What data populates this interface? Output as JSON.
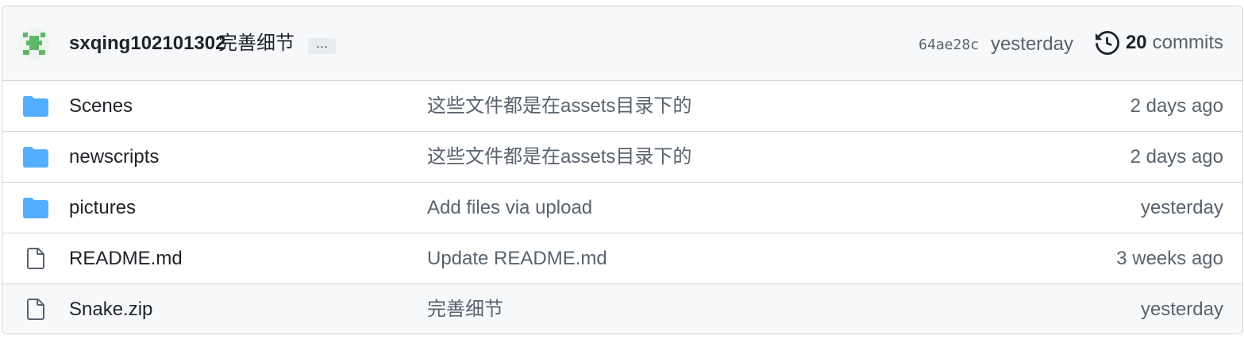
{
  "latest_commit": {
    "author": "sxqing102101302",
    "message": "完善细节",
    "ellipsis": "…",
    "sha": "64ae28c",
    "time": "yesterday",
    "commit_count": "20",
    "commits_label": "commits",
    "history_icon": "history-icon",
    "avatar_icon": "identicon-avatar"
  },
  "files": [
    {
      "type": "folder",
      "icon": "folder-icon",
      "name": "Scenes",
      "message": "这些文件都是在assets目录下的",
      "age": "2 days ago"
    },
    {
      "type": "folder",
      "icon": "folder-icon",
      "name": "newscripts",
      "message": "这些文件都是在assets目录下的",
      "age": "2 days ago"
    },
    {
      "type": "folder",
      "icon": "folder-icon",
      "name": "pictures",
      "message": "Add files via upload",
      "age": "yesterday"
    },
    {
      "type": "file",
      "icon": "file-icon",
      "name": "README.md",
      "message": "Update README.md",
      "age": "3 weeks ago"
    },
    {
      "type": "file",
      "icon": "file-icon",
      "name": "Snake.zip",
      "message": "完善细节",
      "age": "yesterday"
    }
  ],
  "colors": {
    "folder": "#54aeff",
    "file_icon": "#59636e",
    "identicon": "#5fb866"
  }
}
